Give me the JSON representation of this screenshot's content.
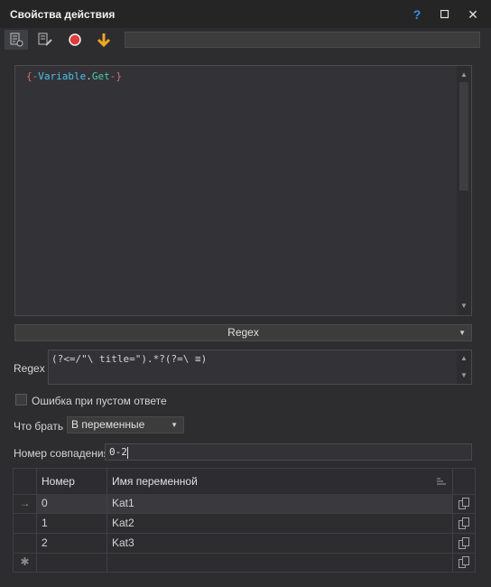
{
  "window": {
    "title": "Свойства действия",
    "help_label": "?",
    "maximize_label": "☐",
    "close_label": "✕"
  },
  "toolbar": {
    "icons": [
      "properties-icon",
      "edit-icon",
      "record-icon",
      "arrow-down-icon"
    ]
  },
  "editor": {
    "code_open": "{-",
    "code_var": "Variable",
    "code_dot": ".",
    "code_get": "Get",
    "code_close": "-}"
  },
  "mode": {
    "selected": "Regex"
  },
  "regex": {
    "label": "Regex",
    "value": "(?<=/\"\\ title=\").*?(?=\\ ≡)"
  },
  "empty_error": {
    "label": "Ошибка при пустом ответе",
    "checked": false
  },
  "what_take": {
    "label": "Что брать",
    "selected": "В переменные"
  },
  "match_number": {
    "label": "Номер совпадения",
    "value": "0-2"
  },
  "table": {
    "headers": [
      "Номер",
      "Имя переменной"
    ],
    "rows": [
      {
        "marker": "→",
        "number": "0",
        "name": "Kat1"
      },
      {
        "marker": "",
        "number": "1",
        "name": "Kat2"
      },
      {
        "marker": "",
        "number": "2",
        "name": "Kat3"
      },
      {
        "marker": "✱",
        "number": "",
        "name": ""
      }
    ]
  },
  "colors": {
    "background": "#2d2d30",
    "accent_help": "#3b8eea",
    "record": "#e03c3c",
    "arrow": "#f0a820",
    "code_brace": "#e06c75",
    "code_variable": "#4fc1e9",
    "code_get": "#4ec9b0"
  }
}
